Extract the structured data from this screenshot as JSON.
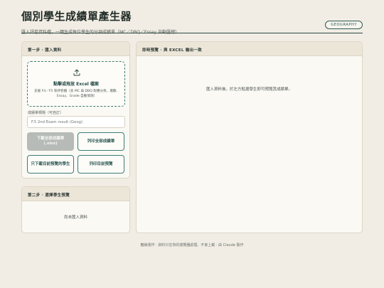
{
  "header": {
    "title": "個別學生成績單產生器",
    "subtitle": "匯入評卷資料檔，一鍵生成每位學生的分項成績單（MC／DBQ／Essay 自動匯總）",
    "badge": "GEOGRAPHY"
  },
  "step1": {
    "heading": "第一步 · 匯入資料",
    "dropzone": {
      "icon": "upload-icon",
      "title": "點擊或拖放 Excel 檔案",
      "hint": "支援 F4／F5 等評卷檔（含 MC 與 DBQ 對應分頁，選數、Essay、Grade 自動偵測）"
    },
    "title_field": {
      "label": "成績單標題（可自訂）",
      "value": "F.5 2nd Exam result (Geog)"
    },
    "buttons": {
      "download_all": "下載全部成績單 (.xlsx)",
      "print_all": "列印全部成績單",
      "download_current": "只下載目前預覽的學生",
      "print_current": "列印目前預覽"
    }
  },
  "step2": {
    "heading": "第二步 · 選擇學生預覽",
    "empty": "尚未匯入資料"
  },
  "preview": {
    "heading": "即時預覽 · 與 EXCEL 輸出一致",
    "message": "匯入資料後，於左方點選學生即可預覽其成績單。"
  },
  "footer": "離線運作 · 資料只在你的瀏覽器處理，不會上載 · 由 Claude 製作",
  "colors": {
    "accent": "#3e7c76",
    "background": "#f1ede4",
    "panel_header": "#ece6d9",
    "disabled": "#b6bbb8"
  }
}
